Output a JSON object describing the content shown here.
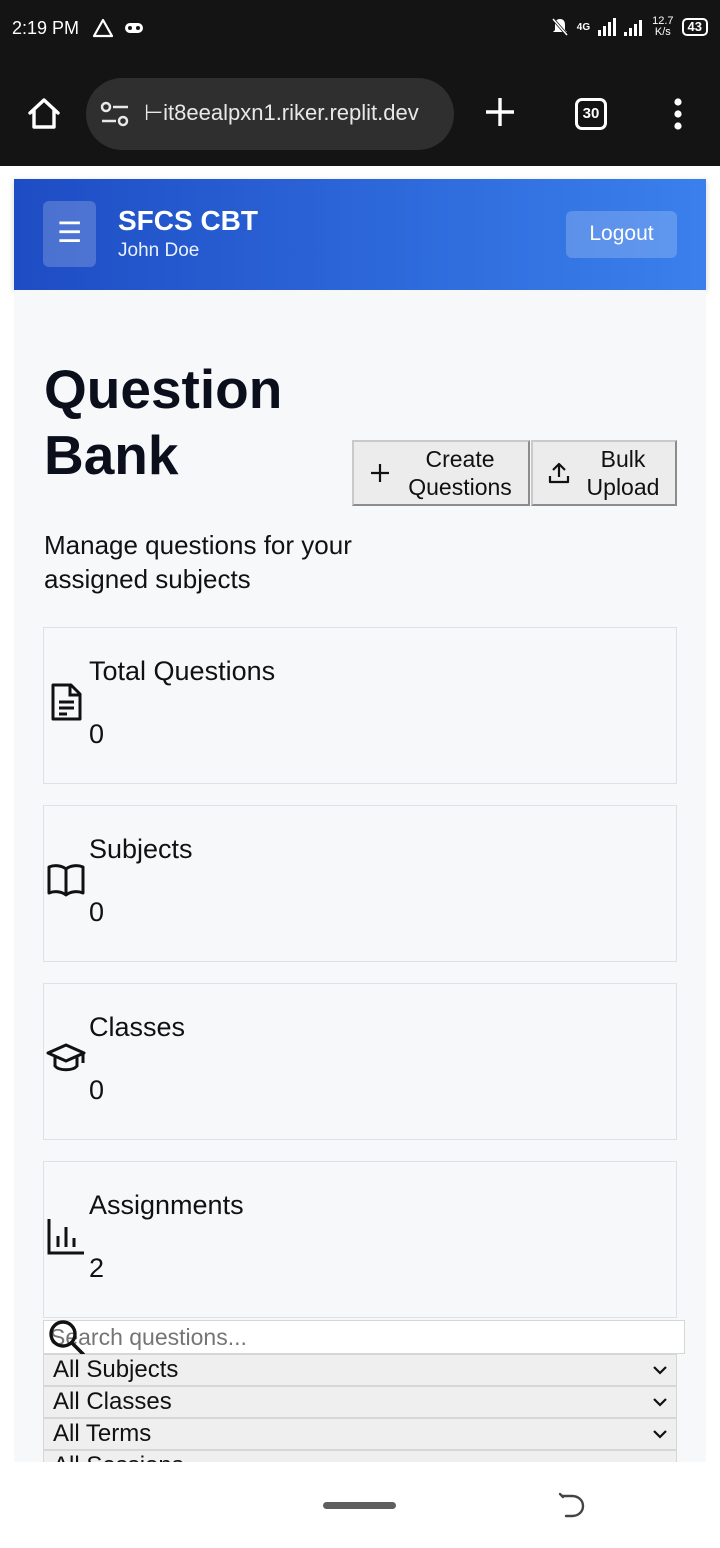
{
  "status_bar": {
    "time": "2:19 PM",
    "network": "4G",
    "speed_value": "12.7",
    "speed_unit": "K/s",
    "battery": "43"
  },
  "browser": {
    "url": "⊢it8eealpxn1.riker.replit.dev",
    "tab_count": "30"
  },
  "app": {
    "title": "SFCS CBT",
    "user": "John Doe",
    "menu_icon": "☰",
    "logout_label": "Logout"
  },
  "page": {
    "title": "Question Bank",
    "subtitle": "Manage questions for your assigned subjects",
    "create_button": "Create\nQuestions",
    "bulk_button": "Bulk\nUpload"
  },
  "stats": [
    {
      "label": "Total Questions",
      "value": "0",
      "icon": "file-text-icon"
    },
    {
      "label": "Subjects",
      "value": "0",
      "icon": "book-icon"
    },
    {
      "label": "Classes",
      "value": "0",
      "icon": "graduation-cap-icon"
    },
    {
      "label": "Assignments",
      "value": "2",
      "icon": "bar-chart-icon"
    }
  ],
  "filters": {
    "search_placeholder": "Search questions...",
    "subjects": "All Subjects",
    "classes": "All Classes",
    "terms": "All Terms",
    "sessions": "All Sessions"
  }
}
